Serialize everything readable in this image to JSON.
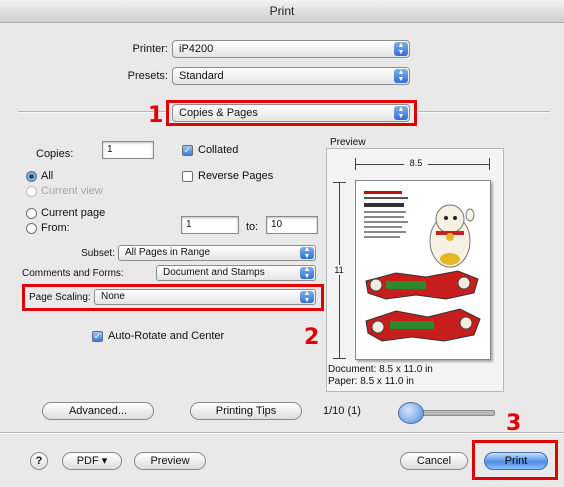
{
  "window": {
    "title": "Print"
  },
  "printer": {
    "label": "Printer:",
    "value": "iP4200"
  },
  "presets": {
    "label": "Presets:",
    "value": "Standard"
  },
  "panel": {
    "value": "Copies & Pages"
  },
  "copies": {
    "label": "Copies:",
    "value": "1",
    "collated_label": "Collated",
    "reverse_label": "Reverse Pages"
  },
  "pages": {
    "all_label": "All",
    "current_view_label": "Current view",
    "current_page_label": "Current page",
    "from_label": "From:",
    "from_value": "1",
    "to_label": "to:",
    "to_value": "10"
  },
  "subset": {
    "label": "Subset:",
    "value": "All Pages in Range"
  },
  "comments": {
    "label": "Comments and Forms:",
    "value": "Document and Stamps"
  },
  "scaling": {
    "label": "Page Scaling:",
    "value": "None"
  },
  "autorotate": {
    "label": "Auto-Rotate and Center"
  },
  "preview": {
    "title": "Preview",
    "width": "8.5",
    "height": "11",
    "document_info": "Document: 8.5 x 11.0 in",
    "paper_info": "Paper: 8.5 x 11.0 in"
  },
  "buttons": {
    "advanced": "Advanced...",
    "printing_tips": "Printing Tips",
    "page_counter": "1/10 (1)",
    "help": "?",
    "pdf": "PDF ▾",
    "preview": "Preview",
    "cancel": "Cancel",
    "print": "Print"
  },
  "annotations": {
    "one": "1",
    "two": "2",
    "three": "3"
  },
  "colors": {
    "annotation": "#e00000",
    "accent": "#3c7bd7"
  }
}
